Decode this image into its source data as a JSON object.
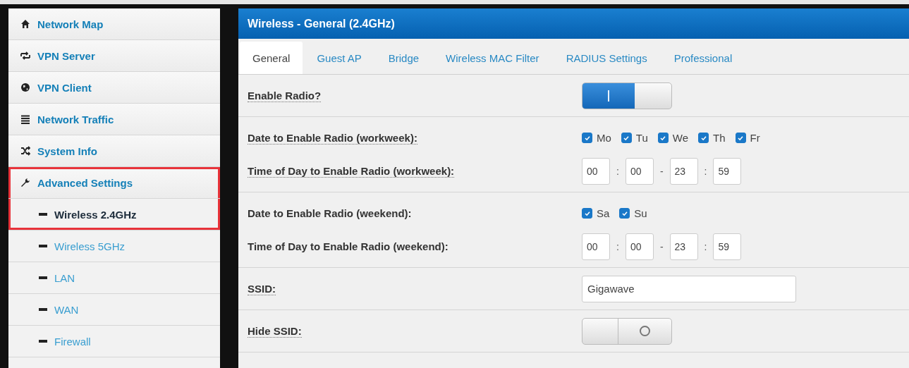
{
  "sidebar": {
    "items": [
      {
        "label": "Network Map",
        "selected": false,
        "highlighted": false
      },
      {
        "label": "VPN Server",
        "selected": false,
        "highlighted": false
      },
      {
        "label": "VPN Client",
        "selected": false,
        "highlighted": false
      },
      {
        "label": "Network Traffic",
        "selected": false,
        "highlighted": false
      },
      {
        "label": "System Info",
        "selected": false,
        "highlighted": false
      },
      {
        "label": "Advanced Settings",
        "selected": false,
        "highlighted": true,
        "children": [
          {
            "label": "Wireless 2.4GHz",
            "selected": true,
            "highlighted": true
          },
          {
            "label": "Wireless 5GHz",
            "selected": false,
            "highlighted": false
          },
          {
            "label": "LAN",
            "selected": false,
            "highlighted": false
          },
          {
            "label": "WAN",
            "selected": false,
            "highlighted": false
          },
          {
            "label": "Firewall",
            "selected": false,
            "highlighted": false
          }
        ]
      }
    ]
  },
  "panel": {
    "title": "Wireless - General (2.4GHz)",
    "tabs": [
      {
        "label": "General",
        "selected": true
      },
      {
        "label": "Guest AP",
        "selected": false
      },
      {
        "label": "Bridge",
        "selected": false
      },
      {
        "label": "Wireless MAC Filter",
        "selected": false
      },
      {
        "label": "RADIUS Settings",
        "selected": false
      },
      {
        "label": "Professional",
        "selected": false
      }
    ],
    "sections": [
      {
        "rows": [
          {
            "label": "Enable Radio?",
            "hint": true,
            "kind": "toggle",
            "on": true
          }
        ]
      },
      {
        "rows": [
          {
            "label": "Date to Enable Radio (workweek):",
            "hint": true,
            "kind": "days",
            "days": [
              {
                "label": "Mo",
                "checked": true
              },
              {
                "label": "Tu",
                "checked": true
              },
              {
                "label": "We",
                "checked": true
              },
              {
                "label": "Th",
                "checked": true
              },
              {
                "label": "Fr",
                "checked": true
              }
            ]
          },
          {
            "label": "Time of Day to Enable Radio (workweek):",
            "hint": true,
            "kind": "time",
            "parts": [
              {
                "kind": "field",
                "value": "00"
              },
              {
                "kind": "sep",
                "text": ":"
              },
              {
                "kind": "field",
                "value": "00"
              },
              {
                "kind": "sep",
                "text": "-"
              },
              {
                "kind": "field",
                "value": "23"
              },
              {
                "kind": "sep",
                "text": ":"
              },
              {
                "kind": "field",
                "value": "59"
              }
            ]
          }
        ]
      },
      {
        "rows": [
          {
            "label": "Date to Enable Radio (weekend):",
            "hint": false,
            "kind": "days",
            "days": [
              {
                "label": "Sa",
                "checked": true
              },
              {
                "label": "Su",
                "checked": true
              }
            ]
          },
          {
            "label": "Time of Day to Enable Radio (weekend):",
            "hint": false,
            "kind": "time",
            "parts": [
              {
                "kind": "field",
                "value": "00"
              },
              {
                "kind": "sep",
                "text": ":"
              },
              {
                "kind": "field",
                "value": "00"
              },
              {
                "kind": "sep",
                "text": "-"
              },
              {
                "kind": "field",
                "value": "23"
              },
              {
                "kind": "sep",
                "text": ":"
              },
              {
                "kind": "field",
                "value": "59"
              }
            ]
          }
        ]
      },
      {
        "rows": [
          {
            "label": "SSID:",
            "hint": true,
            "kind": "text",
            "value": "Gigawave"
          }
        ]
      },
      {
        "rows": [
          {
            "label": "Hide SSID:",
            "hint": true,
            "kind": "toggle",
            "on": false
          }
        ]
      }
    ]
  }
}
